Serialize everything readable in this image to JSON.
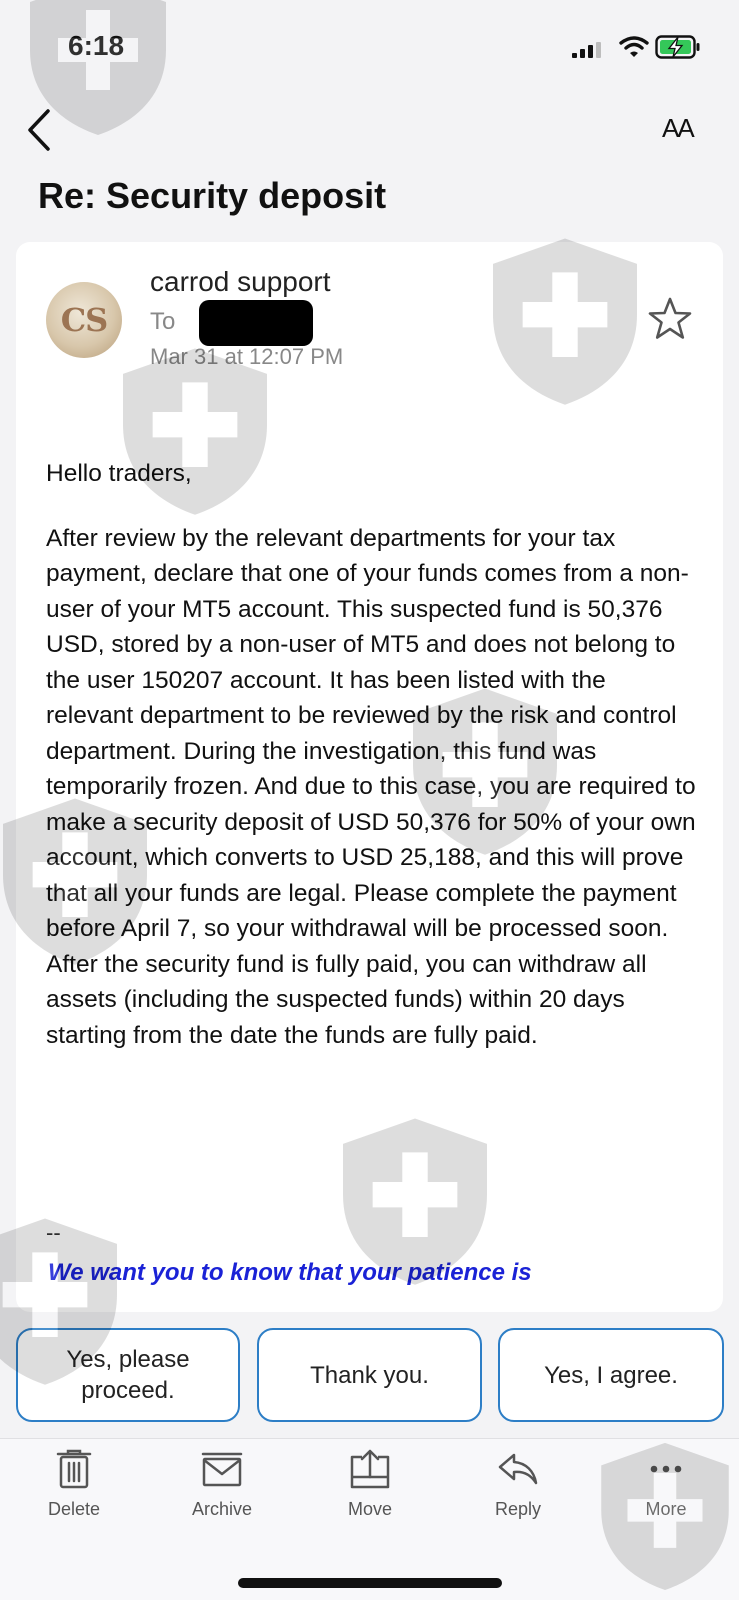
{
  "status_bar": {
    "time": "6:18",
    "icons": [
      "cellular-signal-icon",
      "wifi-icon",
      "battery-charging-icon"
    ],
    "battery_color": "#34c759"
  },
  "nav": {
    "back_icon": "chevron-left-icon",
    "text_size_label": "AA"
  },
  "email": {
    "subject": "Re: Security deposit",
    "sender_initials": "CS",
    "sender_name": "carrod support",
    "to_label": "To",
    "date": "Mar 31 at 12:07 PM",
    "star_icon": "star-outline-icon",
    "greeting": "Hello traders,",
    "body": "After review by the relevant departments for your tax payment, declare that one of your funds comes from a non-user of your MT5 account. This suspected fund is 50,376 USD, stored by a non-user of MT5 and does not belong to the user 150207 account. It has been listed with the relevant department to be reviewed by the risk and control department. During the investigation, this fund was temporarily frozen. And due to this case, you are required to make a security deposit of USD 50,376 for 50% of your own account, which converts to USD 25,188, and this will prove that all your funds are legal. Please complete the payment before April 7, so your withdrawal will be processed soon. After the security fund is fully paid, you can withdraw all assets (including the suspected funds) within 20 days starting from the date the funds are fully paid.",
    "signature_separator": "--",
    "signature_line": "We want you to know that your patience is"
  },
  "smart_replies": [
    {
      "label": "Yes, please proceed."
    },
    {
      "label": "Thank you."
    },
    {
      "label": "Yes, I agree."
    }
  ],
  "toolbar": [
    {
      "label": "Delete",
      "icon": "trash-icon"
    },
    {
      "label": "Archive",
      "icon": "archive-icon"
    },
    {
      "label": "Move",
      "icon": "move-icon"
    },
    {
      "label": "Reply",
      "icon": "reply-icon"
    },
    {
      "label": "More",
      "icon": "more-dots-icon"
    }
  ],
  "colors": {
    "accent_blue": "#2d7ec6",
    "signature_blue": "#1a22d6"
  }
}
